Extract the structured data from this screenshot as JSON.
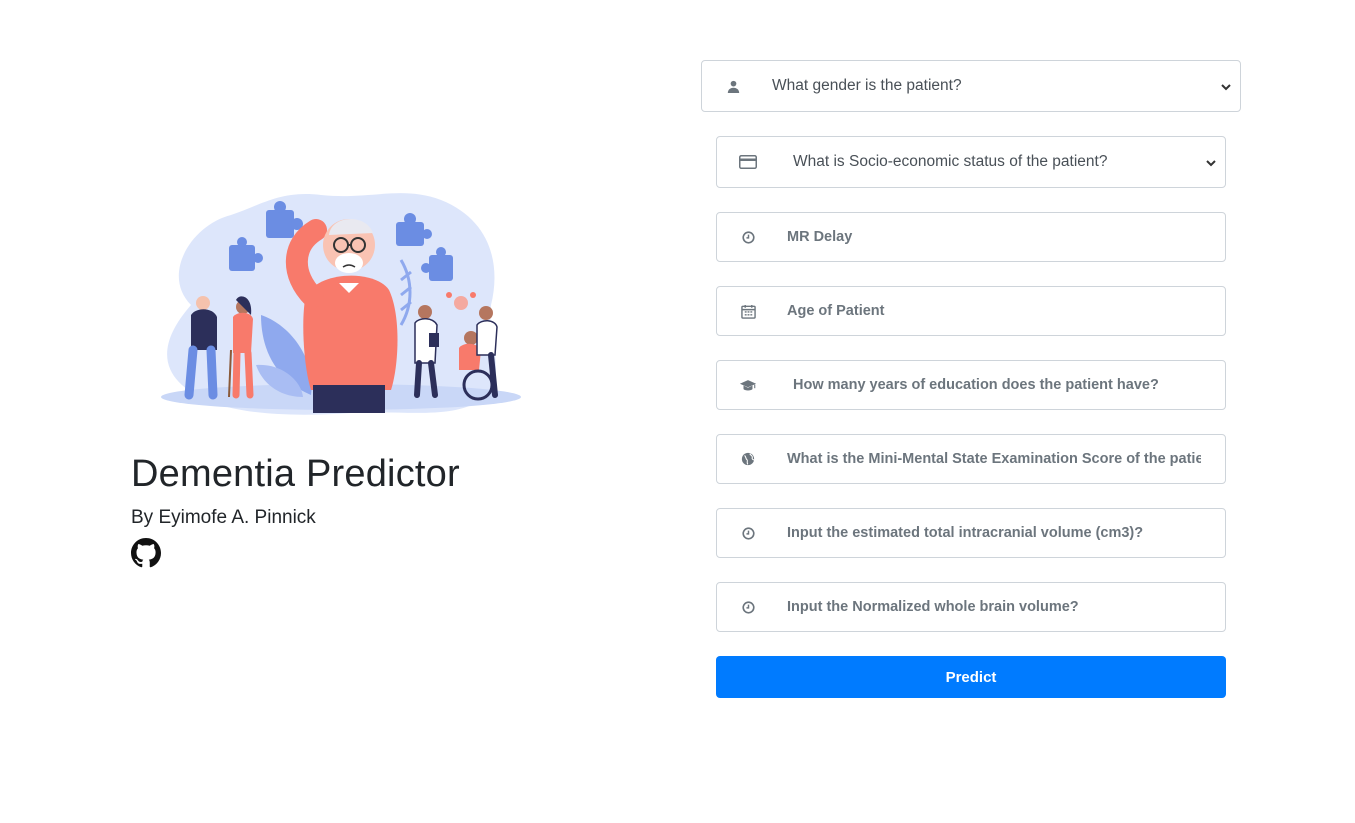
{
  "header": {
    "title": "Dementia Predictor",
    "author": "By Eyimofe A. Pinnick"
  },
  "icons": {
    "github": "github-icon"
  },
  "form": {
    "gender": {
      "label": "What gender is the patient?",
      "icon": "user-icon"
    },
    "ses": {
      "label": "What is Socio-economic status of the patient?",
      "icon": "credit-card-icon"
    },
    "mr_delay": {
      "placeholder": "MR Delay",
      "icon": "clock-icon"
    },
    "age": {
      "placeholder": "Age of Patient",
      "icon": "calendar-icon"
    },
    "education": {
      "placeholder": "How many years of education does the patient have?",
      "icon": "graduation-cap-icon"
    },
    "mmse": {
      "placeholder": "What is the Mini-Mental State Examination Score of the patient?",
      "icon": "globe-icon"
    },
    "etiv": {
      "placeholder": "Input the estimated total intracranial volume (cm3)?",
      "icon": "clock-icon"
    },
    "nwbv": {
      "placeholder": "Input the Normalized whole brain volume?",
      "icon": "clock-icon"
    },
    "submit_label": "Predict"
  },
  "colors": {
    "primary": "#007bff",
    "border": "#ced4da",
    "placeholder": "#6c757d",
    "illustration_blob": "#dde6fb",
    "illustration_accent": "#f87a6b",
    "illustration_puzzle": "#6b8de3"
  }
}
